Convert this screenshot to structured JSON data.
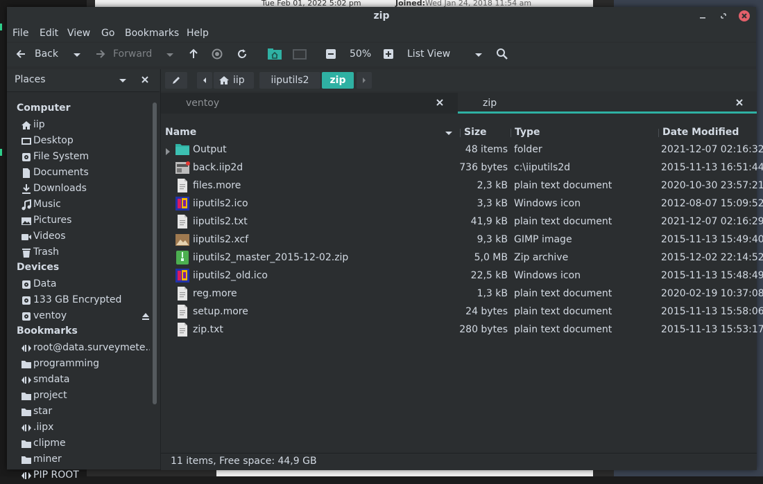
{
  "background": {
    "browser_text_1": "Tue Feb 01, 2022 5:02 pm",
    "browser_text_2_label": "Joined:",
    "browser_text_2_value": "Wed Jan 24, 2018 11:54 am"
  },
  "window": {
    "title": "zip"
  },
  "menu": [
    "File",
    "Edit",
    "View",
    "Go",
    "Bookmarks",
    "Help"
  ],
  "toolbar": {
    "back_label": "Back",
    "forward_label": "Forward",
    "zoom_value": "50%",
    "view_mode": "List View"
  },
  "sidebar": {
    "header": "Places",
    "sections": [
      {
        "title": "Computer",
        "items": [
          {
            "label": "iip",
            "icon": "home-icon"
          },
          {
            "label": "Desktop",
            "icon": "desktop-icon"
          },
          {
            "label": "File System",
            "icon": "drive-icon"
          },
          {
            "label": "Documents",
            "icon": "document-icon"
          },
          {
            "label": "Downloads",
            "icon": "download-icon"
          },
          {
            "label": "Music",
            "icon": "music-icon"
          },
          {
            "label": "Pictures",
            "icon": "picture-icon"
          },
          {
            "label": "Videos",
            "icon": "video-icon"
          },
          {
            "label": "Trash",
            "icon": "trash-icon"
          }
        ]
      },
      {
        "title": "Devices",
        "items": [
          {
            "label": "Data",
            "icon": "drive-icon"
          },
          {
            "label": "133 GB Encrypted",
            "icon": "drive-icon"
          },
          {
            "label": "ventoy",
            "icon": "drive-icon"
          }
        ]
      },
      {
        "title": "Bookmarks",
        "items": [
          {
            "label": "root@data.surveymete...",
            "icon": "network-icon"
          },
          {
            "label": "programming",
            "icon": "folder-icon"
          },
          {
            "label": "smdata",
            "icon": "network-icon"
          },
          {
            "label": "project",
            "icon": "folder-icon"
          },
          {
            "label": "star",
            "icon": "folder-icon"
          },
          {
            "label": ".iipx",
            "icon": "network-icon"
          },
          {
            "label": "clipme",
            "icon": "folder-icon"
          },
          {
            "label": "miner",
            "icon": "folder-icon"
          },
          {
            "label": "PIP ROOT",
            "icon": "network-icon"
          }
        ]
      }
    ]
  },
  "pathbar": {
    "crumbs": [
      "iip",
      "iiputils2",
      "zip"
    ]
  },
  "tabs": [
    {
      "label": "ventoy"
    },
    {
      "label": "zip"
    }
  ],
  "columns": {
    "name": "Name",
    "size": "Size",
    "type": "Type",
    "date": "Date Modified"
  },
  "files": [
    {
      "name": "Output",
      "size": "48 items",
      "type": "folder",
      "date": "2021-12-07 02:16:32",
      "icon": "folder-icon"
    },
    {
      "name": "back.iip2d",
      "size": "736 bytes",
      "type": "c:\\iiputils2d",
      "date": "2015-11-13 16:51:44",
      "icon": "app-file-icon"
    },
    {
      "name": "files.more",
      "size": "2,3 kB",
      "type": "plain text document",
      "date": "2020-10-30 23:57:21",
      "icon": "text-file-icon"
    },
    {
      "name": "iiputils2.ico",
      "size": "3,3 kB",
      "type": "Windows icon",
      "date": "2012-08-07 15:09:52",
      "icon": "ico-file-icon"
    },
    {
      "name": "iiputils2.txt",
      "size": "41,9 kB",
      "type": "plain text document",
      "date": "2021-12-07 02:16:29",
      "icon": "text-file-icon"
    },
    {
      "name": "iiputils2.xcf",
      "size": "9,3 kB",
      "type": "GIMP image",
      "date": "2015-11-13 15:49:40",
      "icon": "image-file-icon"
    },
    {
      "name": "iiputils2_master_2015-12-02.zip",
      "size": "5,0 MB",
      "type": "Zip archive",
      "date": "2015-12-02 22:14:52",
      "icon": "zip-file-icon"
    },
    {
      "name": "iiputils2_old.ico",
      "size": "22,5 kB",
      "type": "Windows icon",
      "date": "2015-11-13 15:48:49",
      "icon": "ico-file-icon"
    },
    {
      "name": "reg.more",
      "size": "1,3 kB",
      "type": "plain text document",
      "date": "2020-02-19 10:37:08",
      "icon": "text-file-icon"
    },
    {
      "name": "setup.more",
      "size": "24 bytes",
      "type": "plain text document",
      "date": "2015-11-13 15:58:06",
      "icon": "text-file-icon"
    },
    {
      "name": "zip.txt",
      "size": "280 bytes",
      "type": "plain text document",
      "date": "2015-11-13 15:53:17",
      "icon": "text-file-icon"
    }
  ],
  "status": {
    "text": "11 items, Free space: 44,9 GB"
  },
  "colors": {
    "accent": "#2fb1a3",
    "close": "#e3606a",
    "text": "#d3dae3"
  }
}
